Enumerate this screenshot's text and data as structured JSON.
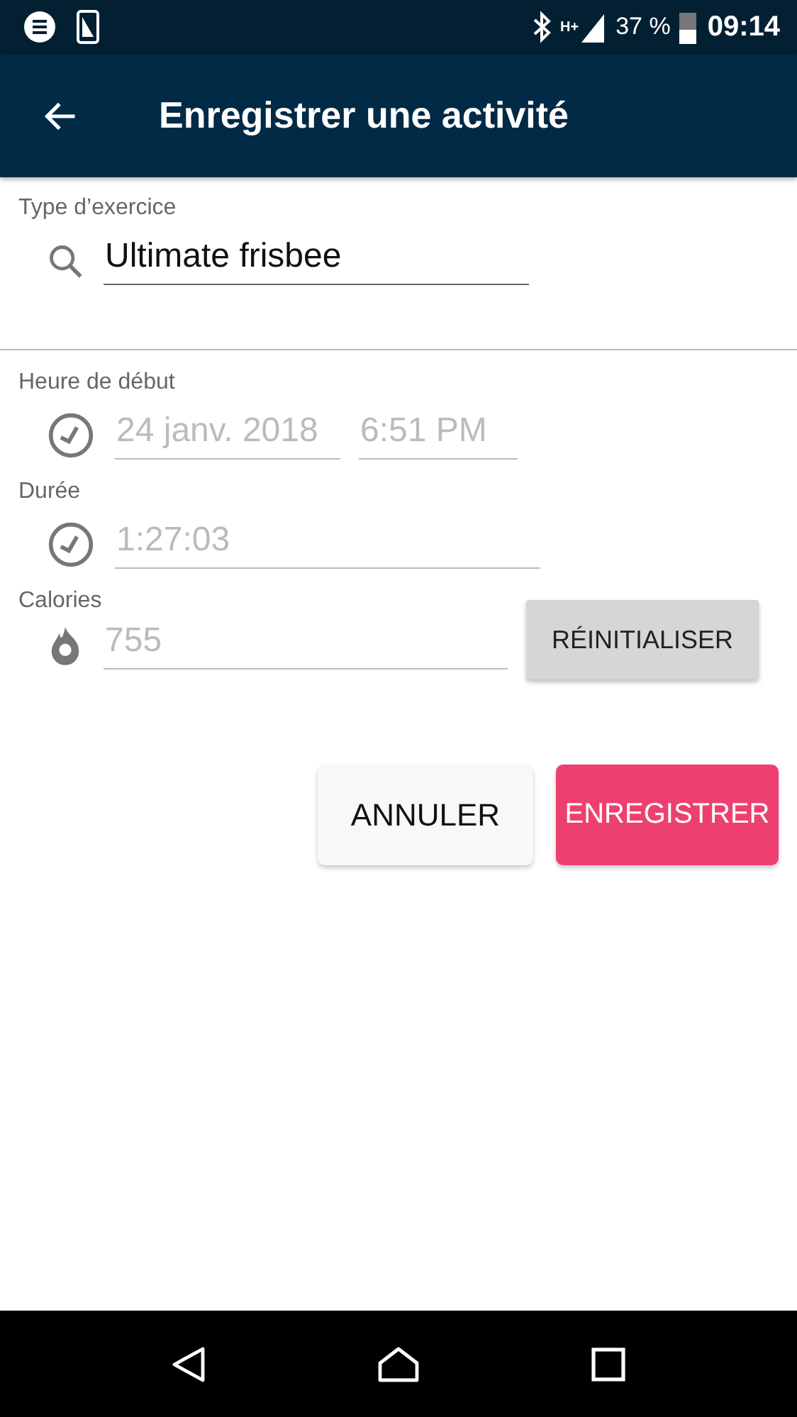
{
  "status_bar": {
    "network": "H+",
    "battery": "37 %",
    "time": "09:14"
  },
  "app_bar": {
    "title": "Enregistrer une activité"
  },
  "exercise_type": {
    "label": "Type d’exercice",
    "value": "Ultimate frisbee"
  },
  "start_time": {
    "label": "Heure de début",
    "date": "24 janv. 2018",
    "time": "6:51 PM"
  },
  "duration": {
    "label": "Durée",
    "value": "1:27:03"
  },
  "calories": {
    "label": "Calories",
    "value": "755",
    "reset_button": "RÉINITIALISER"
  },
  "buttons": [
    {
      "label": "ANNULER",
      "kind": "secondary"
    },
    {
      "label": "ENREGISTRER",
      "kind": "primary"
    }
  ]
}
